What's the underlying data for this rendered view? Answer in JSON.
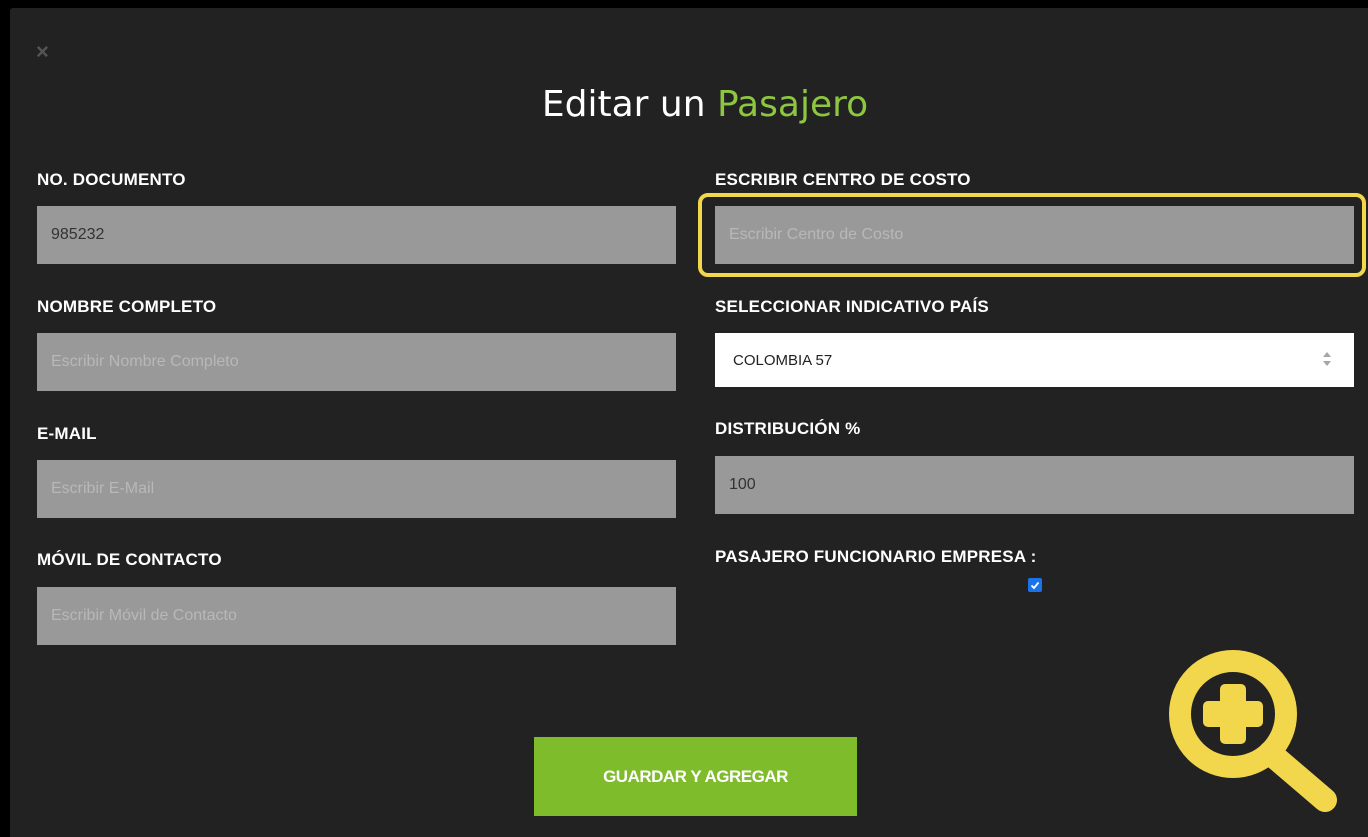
{
  "modal": {
    "close_symbol": "×",
    "title_prefix": "Editar un",
    "title_accent": "Pasajero"
  },
  "fields": {
    "documento": {
      "label": "NO. DOCUMENTO",
      "value": "985232",
      "placeholder": ""
    },
    "nombre": {
      "label": "NOMBRE COMPLETO",
      "value": "",
      "placeholder": "Escribir Nombre Completo"
    },
    "email": {
      "label": "E-MAIL",
      "value": "",
      "placeholder": "Escribir E-Mail"
    },
    "movil": {
      "label": "MÓVIL DE CONTACTO",
      "value": "",
      "placeholder": "Escribir Móvil de Contacto"
    },
    "centro_costo": {
      "label": "ESCRIBIR CENTRO DE COSTO",
      "value": "",
      "placeholder": "Escribir Centro de Costo"
    },
    "indicativo": {
      "label": "SELECCIONAR INDICATIVO PAÍS",
      "selected": "COLOMBIA 57"
    },
    "distribucion": {
      "label": "DISTRIBUCIÓN %",
      "value": "100",
      "placeholder": ""
    },
    "funcionario": {
      "label": "PASAJERO FUNCIONARIO EMPRESA :",
      "checked": true
    }
  },
  "actions": {
    "save_label": "GUARDAR Y AGREGAR"
  },
  "colors": {
    "accent": "#8dc63f",
    "button": "#7fbc2c",
    "highlight": "#f2d64b",
    "background": "#222222",
    "input": "#999999"
  },
  "overlay": {
    "icon": "zoom-in-icon"
  }
}
